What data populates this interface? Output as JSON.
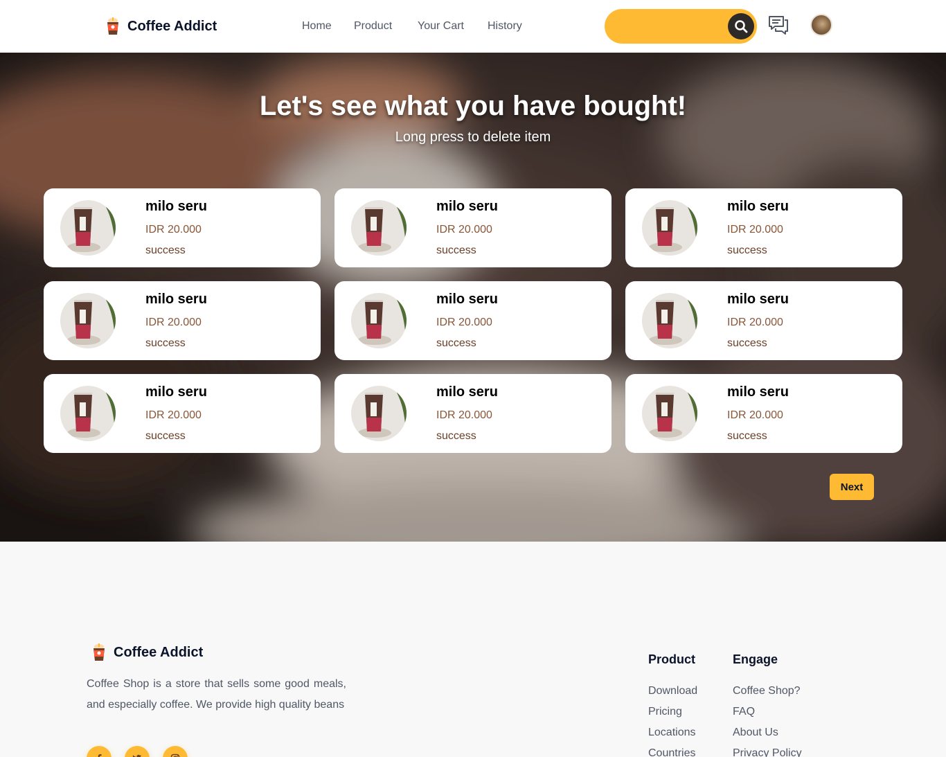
{
  "colors": {
    "accent": "#ffba33",
    "dark": "#0b132a",
    "price": "#895537",
    "status": "#6a4029"
  },
  "navbar": {
    "brand": "Coffee Addict",
    "links": [
      "Home",
      "Product",
      "Your Cart",
      "History"
    ],
    "search_placeholder": "",
    "icons": [
      "search-icon",
      "chat-icon",
      "avatar"
    ]
  },
  "hero": {
    "title": "Let's see what you have bought!",
    "subtitle": "Long press to delete item"
  },
  "history": {
    "items": [
      {
        "name": "milo seru",
        "price": "IDR 20.000",
        "status": "success"
      },
      {
        "name": "milo seru",
        "price": "IDR 20.000",
        "status": "success"
      },
      {
        "name": "milo seru",
        "price": "IDR 20.000",
        "status": "success"
      },
      {
        "name": "milo seru",
        "price": "IDR 20.000",
        "status": "success"
      },
      {
        "name": "milo seru",
        "price": "IDR 20.000",
        "status": "success"
      },
      {
        "name": "milo seru",
        "price": "IDR 20.000",
        "status": "success"
      },
      {
        "name": "milo seru",
        "price": "IDR 20.000",
        "status": "success"
      },
      {
        "name": "milo seru",
        "price": "IDR 20.000",
        "status": "success"
      },
      {
        "name": "milo seru",
        "price": "IDR 20.000",
        "status": "success"
      }
    ],
    "next_label": "Next"
  },
  "footer": {
    "brand": "Coffee Addict",
    "description": "Coffee Shop is a store that sells some good meals, and especially coffee. We provide high quality beans",
    "socials": [
      "facebook-icon",
      "twitter-icon",
      "instagram-icon"
    ],
    "columns": [
      {
        "title": "Product",
        "links": [
          "Download",
          "Pricing",
          "Locations",
          "Countries"
        ]
      },
      {
        "title": "Engage",
        "links": [
          "Coffee Shop?",
          "FAQ",
          "About Us",
          "Privacy Policy"
        ]
      }
    ]
  }
}
